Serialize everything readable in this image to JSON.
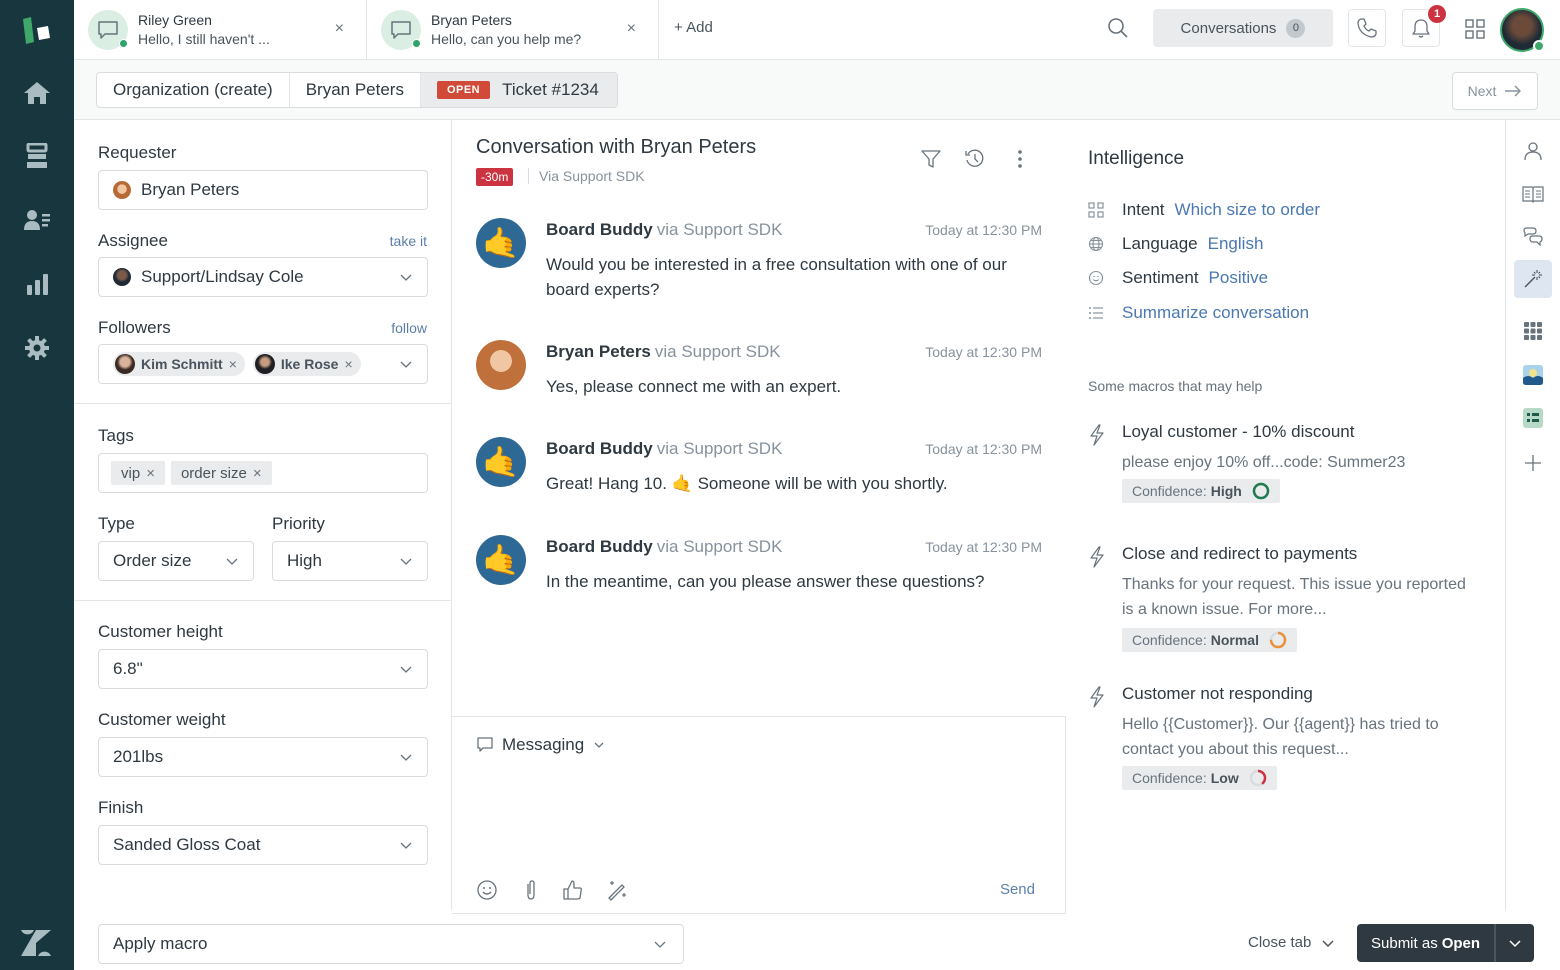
{
  "tabs": [
    {
      "name": "Riley Green",
      "preview": "Hello, I still haven't ..."
    },
    {
      "name": "Bryan Peters",
      "preview": "Hello, can you help me?"
    }
  ],
  "topbar": {
    "add_label": "+ Add",
    "conversations_label": "Conversations",
    "conversations_count": "0",
    "notification_count": "1"
  },
  "breadcrumb": {
    "organization": "Organization (create)",
    "requester": "Bryan Peters",
    "status_badge": "OPEN",
    "ticket": "Ticket #1234",
    "next_label": "Next"
  },
  "props": {
    "requester_label": "Requester",
    "requester_value": "Bryan Peters",
    "assignee_label": "Assignee",
    "assignee_link": "take it",
    "assignee_value": "Support/Lindsay Cole",
    "followers_label": "Followers",
    "followers_link": "follow",
    "followers": [
      "Kim Schmitt",
      "Ike Rose"
    ],
    "tags_label": "Tags",
    "tags": [
      "vip",
      "order size"
    ],
    "type_label": "Type",
    "type_value": "Order size",
    "priority_label": "Priority",
    "priority_value": "High",
    "height_label": "Customer height",
    "height_value": "6.8\"",
    "weight_label": "Customer weight",
    "weight_value": "201lbs",
    "finish_label": "Finish",
    "finish_value": "Sanded Gloss Coat"
  },
  "conversation": {
    "title": "Conversation with Bryan Peters",
    "sla": "-30m",
    "channel": "Via Support SDK",
    "messages": [
      {
        "author": "Board Buddy",
        "via": "via Support SDK",
        "time": "Today at 12:30 PM",
        "body": "Would you be interested in a free consultation with one of our board experts?"
      },
      {
        "author": "Bryan Peters",
        "via": "via Support SDK",
        "time": "Today at 12:30 PM",
        "body": "Yes, please connect me with an expert."
      },
      {
        "author": "Board Buddy",
        "via": "via Support SDK",
        "time": "Today at 12:30 PM",
        "body": "Great! Hang 10. 🤙 Someone will be with you shortly."
      },
      {
        "author": "Board Buddy",
        "via": "via Support SDK",
        "time": "Today at 12:30 PM",
        "body": " In the meantime, can you please answer these questions?"
      }
    ]
  },
  "composer": {
    "channel_label": "Messaging",
    "send_label": "Send"
  },
  "intelligence": {
    "title": "Intelligence",
    "intent_label": "Intent",
    "intent_value": "Which size to order",
    "language_label": "Language",
    "language_value": "English",
    "sentiment_label": "Sentiment",
    "sentiment_value": "Positive",
    "summarize_label": "Summarize conversation",
    "macros_hint": "Some macros that may help",
    "confidence_prefix": "Confidence:",
    "macros": [
      {
        "title": "Loyal customer - 10% discount",
        "desc": "please enjoy 10% off...code: Summer23",
        "confidence": "High",
        "confidence_pct": 100,
        "color": "#1f7a4f"
      },
      {
        "title": "Close and redirect to payments",
        "desc": "Thanks for your request. This issue you reported is a known issue. For more...",
        "confidence": "Normal",
        "confidence_pct": 75,
        "color": "#e8913a"
      },
      {
        "title": "Customer not responding",
        "desc": "Hello {{Customer}}. Our {{agent}} has tried to contact you about this request...",
        "confidence": "Low",
        "confidence_pct": 40,
        "color": "#cc3340"
      }
    ]
  },
  "footer": {
    "apply_macro": "Apply macro",
    "close_tab": "Close tab",
    "submit_prefix": "Submit as",
    "submit_status": "Open"
  },
  "colors": {
    "nav_bg": "#17363d",
    "link": "#4a78b0",
    "danger": "#cc3340",
    "open_badge": "#d04a37",
    "submit_bg": "#2f3941"
  }
}
